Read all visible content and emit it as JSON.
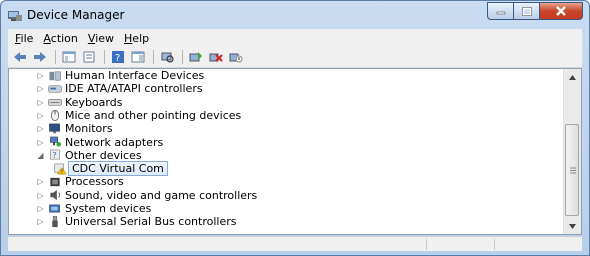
{
  "window": {
    "title": "Device Manager"
  },
  "menu": [
    {
      "label": "File",
      "accel": "F",
      "rest": "ile"
    },
    {
      "label": "Action",
      "accel": "A",
      "rest": "ction"
    },
    {
      "label": "View",
      "accel": "V",
      "rest": "iew"
    },
    {
      "label": "Help",
      "accel": "H",
      "rest": "elp"
    }
  ],
  "toolbar": [
    "back-icon",
    "forward-icon",
    "properties-icon",
    "refresh-icon",
    "help-icon",
    "show-hide-console-tree-icon",
    "scan-hardware-icon",
    "update-driver-icon",
    "uninstall-icon",
    "disable-icon"
  ],
  "tree": [
    {
      "label": "Human Interface Devices",
      "expander": "▷",
      "icon": "hid-icon"
    },
    {
      "label": "IDE ATA/ATAPI controllers",
      "expander": "▷",
      "icon": "ide-icon"
    },
    {
      "label": "Keyboards",
      "expander": "▷",
      "icon": "keyboard-icon"
    },
    {
      "label": "Mice and other pointing devices",
      "expander": "▷",
      "icon": "mouse-icon"
    },
    {
      "label": "Monitors",
      "expander": "▷",
      "icon": "monitor-icon"
    },
    {
      "label": "Network adapters",
      "expander": "▷",
      "icon": "network-icon"
    },
    {
      "label": "Other devices",
      "expander": "◢",
      "icon": "unknown-device-icon"
    },
    {
      "label": "CDC Virtual Com",
      "expander": "",
      "icon": "warning-device-icon",
      "child": true,
      "selected": true
    },
    {
      "label": "Processors",
      "expander": "▷",
      "icon": "processor-icon"
    },
    {
      "label": "Sound, video and game controllers",
      "expander": "▷",
      "icon": "sound-icon"
    },
    {
      "label": "System devices",
      "expander": "▷",
      "icon": "system-icon"
    },
    {
      "label": "Universal Serial Bus controllers",
      "expander": "▷",
      "icon": "usb-icon"
    }
  ],
  "scrollbar": {
    "position_fraction": 0.6
  },
  "colors": {
    "selection": "#dcebfc",
    "selection_border": "#84acdd",
    "close": "#c43a20"
  }
}
